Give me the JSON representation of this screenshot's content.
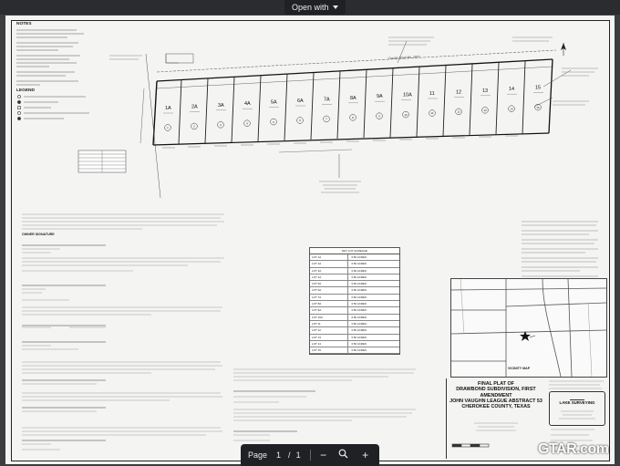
{
  "viewer": {
    "open_with_label": "Open with",
    "page_label": "Page",
    "current_page": "1",
    "separator": "/",
    "total_pages": "1",
    "zoom_out_glyph": "−",
    "zoom_in_glyph": "+"
  },
  "plat": {
    "notes_title": "NOTES",
    "legend_title": "LEGEND",
    "county_road": "County Road No. 3800",
    "lots": [
      "1A",
      "2A",
      "3A",
      "4A",
      "5A",
      "6A",
      "7A",
      "8A",
      "9A",
      "10A",
      "11",
      "12",
      "13",
      "14",
      "15"
    ],
    "lot_circles": [
      "1",
      "2",
      "3",
      "4",
      "5",
      "6",
      "7",
      "8",
      "9",
      "10",
      "11",
      "12",
      "13",
      "14",
      "15"
    ],
    "owner_label": "OWNER SIGNATURE",
    "vicinity_label": "VICINITY MAP",
    "title_lines": [
      "FINAL PLAT OF",
      "DRAWBOND SUBDIVISION, FIRST",
      "AMENDMENT",
      "JOHN VAUGHN LEAGUE ABSTRACT 53",
      "CHEROKEE COUNTY, TEXAS"
    ],
    "company_name": "LAKE SURVEYING",
    "lot_table": {
      "header": "NET LOT ACREAGE",
      "rows": [
        [
          "LOT 1A",
          "3.50 ACRES"
        ],
        [
          "LOT 2A",
          "3.50 ACRES"
        ],
        [
          "LOT 3A",
          "3.50 ACRES"
        ],
        [
          "LOT 4A",
          "3.50 ACRES"
        ],
        [
          "LOT 5A",
          "3.50 ACRES"
        ],
        [
          "LOT 6A",
          "3.50 ACRES"
        ],
        [
          "LOT 7A",
          "3.50 ACRES"
        ],
        [
          "LOT 8A",
          "3.50 ACRES"
        ],
        [
          "LOT 9A",
          "3.50 ACRES"
        ],
        [
          "LOT 10A",
          "3.50 ACRES"
        ],
        [
          "LOT 11",
          "3.50 ACRES"
        ],
        [
          "LOT 12",
          "3.50 ACRES"
        ],
        [
          "LOT 13",
          "3.50 ACRES"
        ],
        [
          "LOT 14",
          "3.50 ACRES"
        ],
        [
          "LOT 15",
          "3.50 ACRES"
        ]
      ]
    }
  },
  "watermark": "GTAR.com"
}
